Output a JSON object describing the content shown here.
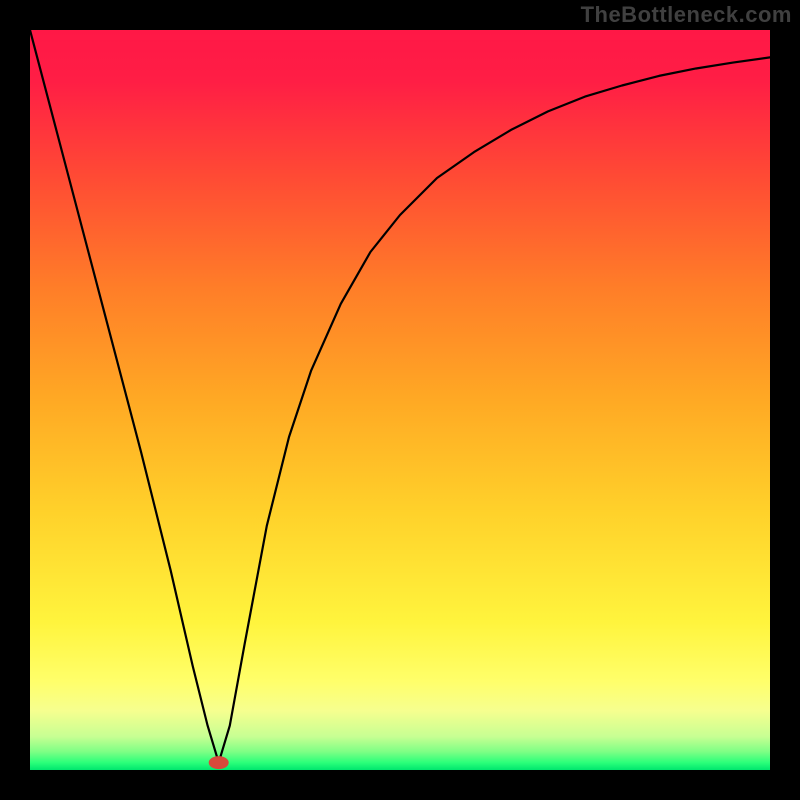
{
  "credit": "TheBottleneck.com",
  "chart_data": {
    "type": "line",
    "title": "",
    "xlabel": "",
    "ylabel": "",
    "xlim": [
      0,
      100
    ],
    "ylim": [
      0,
      100
    ],
    "grid": false,
    "series": [
      {
        "name": "curve",
        "x": [
          0,
          5,
          10,
          15,
          19,
          22,
          24,
          25.5,
          27,
          29,
          32,
          35,
          38,
          42,
          46,
          50,
          55,
          60,
          65,
          70,
          75,
          80,
          85,
          90,
          95,
          100
        ],
        "y": [
          100,
          81,
          62,
          43,
          27,
          14,
          6,
          1,
          6,
          17,
          33,
          45,
          54,
          63,
          70,
          75,
          80,
          83.5,
          86.5,
          89,
          91,
          92.5,
          93.8,
          94.8,
          95.6,
          96.3
        ]
      }
    ],
    "marker": {
      "x": 25.5,
      "y": 1,
      "color": "#d9483b"
    },
    "background_gradient": {
      "type": "vertical",
      "stops": [
        {
          "offset": 0.0,
          "color": "#ff1846"
        },
        {
          "offset": 0.07,
          "color": "#ff1e45"
        },
        {
          "offset": 0.2,
          "color": "#ff4b34"
        },
        {
          "offset": 0.35,
          "color": "#ff7e28"
        },
        {
          "offset": 0.5,
          "color": "#ffa924"
        },
        {
          "offset": 0.65,
          "color": "#ffd12a"
        },
        {
          "offset": 0.8,
          "color": "#fff43d"
        },
        {
          "offset": 0.88,
          "color": "#ffff6a"
        },
        {
          "offset": 0.92,
          "color": "#f6ff8f"
        },
        {
          "offset": 0.955,
          "color": "#c7ff93"
        },
        {
          "offset": 0.975,
          "color": "#7fff85"
        },
        {
          "offset": 0.99,
          "color": "#2bff7a"
        },
        {
          "offset": 1.0,
          "color": "#00e66e"
        }
      ]
    }
  }
}
